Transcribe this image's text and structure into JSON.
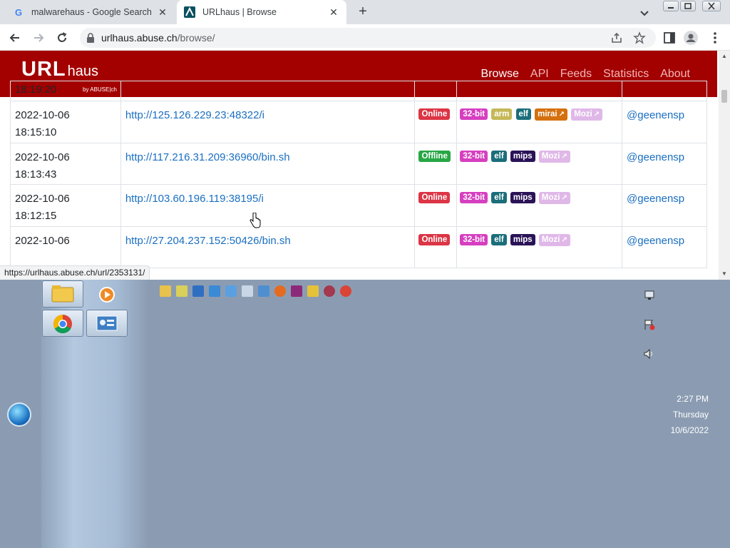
{
  "browser": {
    "tabs": [
      {
        "title": "malwarehaus - Google Search",
        "favicon": "google-g-icon"
      },
      {
        "title": "URLhaus | Browse",
        "favicon": "urlhaus-icon"
      }
    ],
    "close_glyph": "✕",
    "newtab_glyph": "+",
    "address": {
      "host": "urlhaus.abuse.ch",
      "path": "/browse/"
    },
    "status_url": "https://urlhaus.abuse.ch/url/2353131/"
  },
  "site": {
    "logo_main": "URL",
    "logo_sub": "haus",
    "logo_by": "by ABUSE|ch",
    "nav": [
      "Browse",
      "API",
      "Feeds",
      "Statistics",
      "About"
    ]
  },
  "rows": [
    {
      "date": "",
      "time": "18:19:20",
      "url": "",
      "status": "",
      "tags": [],
      "reporter": ""
    },
    {
      "date": "2022-10-06",
      "time": "18:15:10",
      "url": "http://125.126.229.23:48322/i",
      "status": "Online",
      "tags": [
        {
          "label": "32-bit",
          "color": "#d63fc0"
        },
        {
          "label": "arm",
          "color": "#c5b858"
        },
        {
          "label": "elf",
          "color": "#1b6e7a"
        },
        {
          "label": "mirai",
          "color": "#d5700f",
          "ext": true
        },
        {
          "label": "Mozi",
          "color": "#e0b8e8",
          "ext": true
        }
      ],
      "reporter": "@geenensp"
    },
    {
      "date": "2022-10-06",
      "time": "18:13:43",
      "url": "http://117.216.31.209:36960/bin.sh",
      "status": "Offline",
      "tags": [
        {
          "label": "32-bit",
          "color": "#d63fc0"
        },
        {
          "label": "elf",
          "color": "#1b6e7a"
        },
        {
          "label": "mips",
          "color": "#2a1357"
        },
        {
          "label": "Mozi",
          "color": "#e0b8e8",
          "ext": true
        }
      ],
      "reporter": "@geenensp"
    },
    {
      "date": "2022-10-06",
      "time": "18:12:15",
      "url": "http://103.60.196.119:38195/i",
      "status": "Online",
      "tags": [
        {
          "label": "32-bit",
          "color": "#d63fc0"
        },
        {
          "label": "elf",
          "color": "#1b6e7a"
        },
        {
          "label": "mips",
          "color": "#2a1357"
        },
        {
          "label": "Mozi",
          "color": "#e0b8e8",
          "ext": true
        }
      ],
      "reporter": "@geenensp"
    },
    {
      "date": "2022-10-06",
      "time": "",
      "url": "http://27.204.237.152:50426/bin.sh",
      "status": "Online",
      "tags": [
        {
          "label": "32-bit",
          "color": "#d63fc0"
        },
        {
          "label": "elf",
          "color": "#1b6e7a"
        },
        {
          "label": "mips",
          "color": "#2a1357"
        },
        {
          "label": "Mozi",
          "color": "#e0b8e8",
          "ext": true
        }
      ],
      "reporter": "@geenensp"
    }
  ],
  "ext_glyph": "↗",
  "desktop": {
    "clock": {
      "time": "2:27 PM",
      "day": "Thursday",
      "date": "10/6/2022"
    }
  }
}
